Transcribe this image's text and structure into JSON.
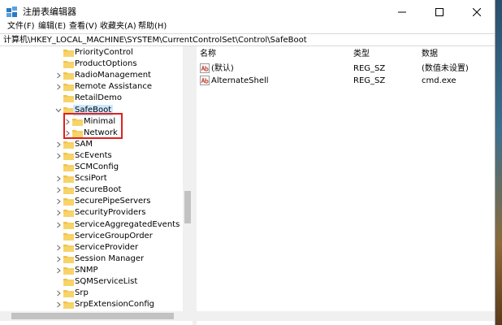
{
  "window": {
    "title": "注册表编辑器"
  },
  "menu": [
    "文件(F)",
    "编辑(E)",
    "查看(V)",
    "收藏夹(A)",
    "帮助(H)"
  ],
  "address": "计算机\\HKEY_LOCAL_MACHINE\\SYSTEM\\CurrentControlSet\\Control\\SafeBoot",
  "tree": [
    {
      "label": "PriorityControl",
      "arrow": false,
      "depth": 0
    },
    {
      "label": "ProductOptions",
      "arrow": false,
      "depth": 0
    },
    {
      "label": "RadioManagement",
      "arrow": true,
      "depth": 0
    },
    {
      "label": "Remote Assistance",
      "arrow": true,
      "depth": 0
    },
    {
      "label": "RetailDemo",
      "arrow": false,
      "depth": 0
    },
    {
      "label": "SafeBoot",
      "arrow": "down",
      "depth": 0,
      "selected": true
    },
    {
      "label": "Minimal",
      "arrow": true,
      "depth": 1
    },
    {
      "label": "Network",
      "arrow": true,
      "depth": 1
    },
    {
      "label": "SAM",
      "arrow": true,
      "depth": 0
    },
    {
      "label": "ScEvents",
      "arrow": true,
      "depth": 0
    },
    {
      "label": "SCMConfig",
      "arrow": false,
      "depth": 0
    },
    {
      "label": "ScsiPort",
      "arrow": true,
      "depth": 0
    },
    {
      "label": "SecureBoot",
      "arrow": true,
      "depth": 0
    },
    {
      "label": "SecurePipeServers",
      "arrow": true,
      "depth": 0
    },
    {
      "label": "SecurityProviders",
      "arrow": true,
      "depth": 0
    },
    {
      "label": "ServiceAggregatedEvents",
      "arrow": true,
      "depth": 0
    },
    {
      "label": "ServiceGroupOrder",
      "arrow": false,
      "depth": 0
    },
    {
      "label": "ServiceProvider",
      "arrow": true,
      "depth": 0
    },
    {
      "label": "Session Manager",
      "arrow": true,
      "depth": 0
    },
    {
      "label": "SNMP",
      "arrow": true,
      "depth": 0
    },
    {
      "label": "SQMServiceList",
      "arrow": false,
      "depth": 0
    },
    {
      "label": "Srp",
      "arrow": true,
      "depth": 0
    },
    {
      "label": "SrpExtensionConfig",
      "arrow": true,
      "depth": 0
    }
  ],
  "list": {
    "headers": {
      "name": "名称",
      "type": "类型",
      "data": "数据"
    },
    "rows": [
      {
        "name": "(默认)",
        "type": "REG_SZ",
        "data": "(数值未设置)",
        "icon": "ab-string-icon"
      },
      {
        "name": "AlternateShell",
        "type": "REG_SZ",
        "data": "cmd.exe",
        "icon": "ab-string-icon"
      }
    ]
  },
  "colors": {
    "folder": "#f0c24b",
    "selection": "#cce8ff",
    "highlight": "#e02020"
  }
}
